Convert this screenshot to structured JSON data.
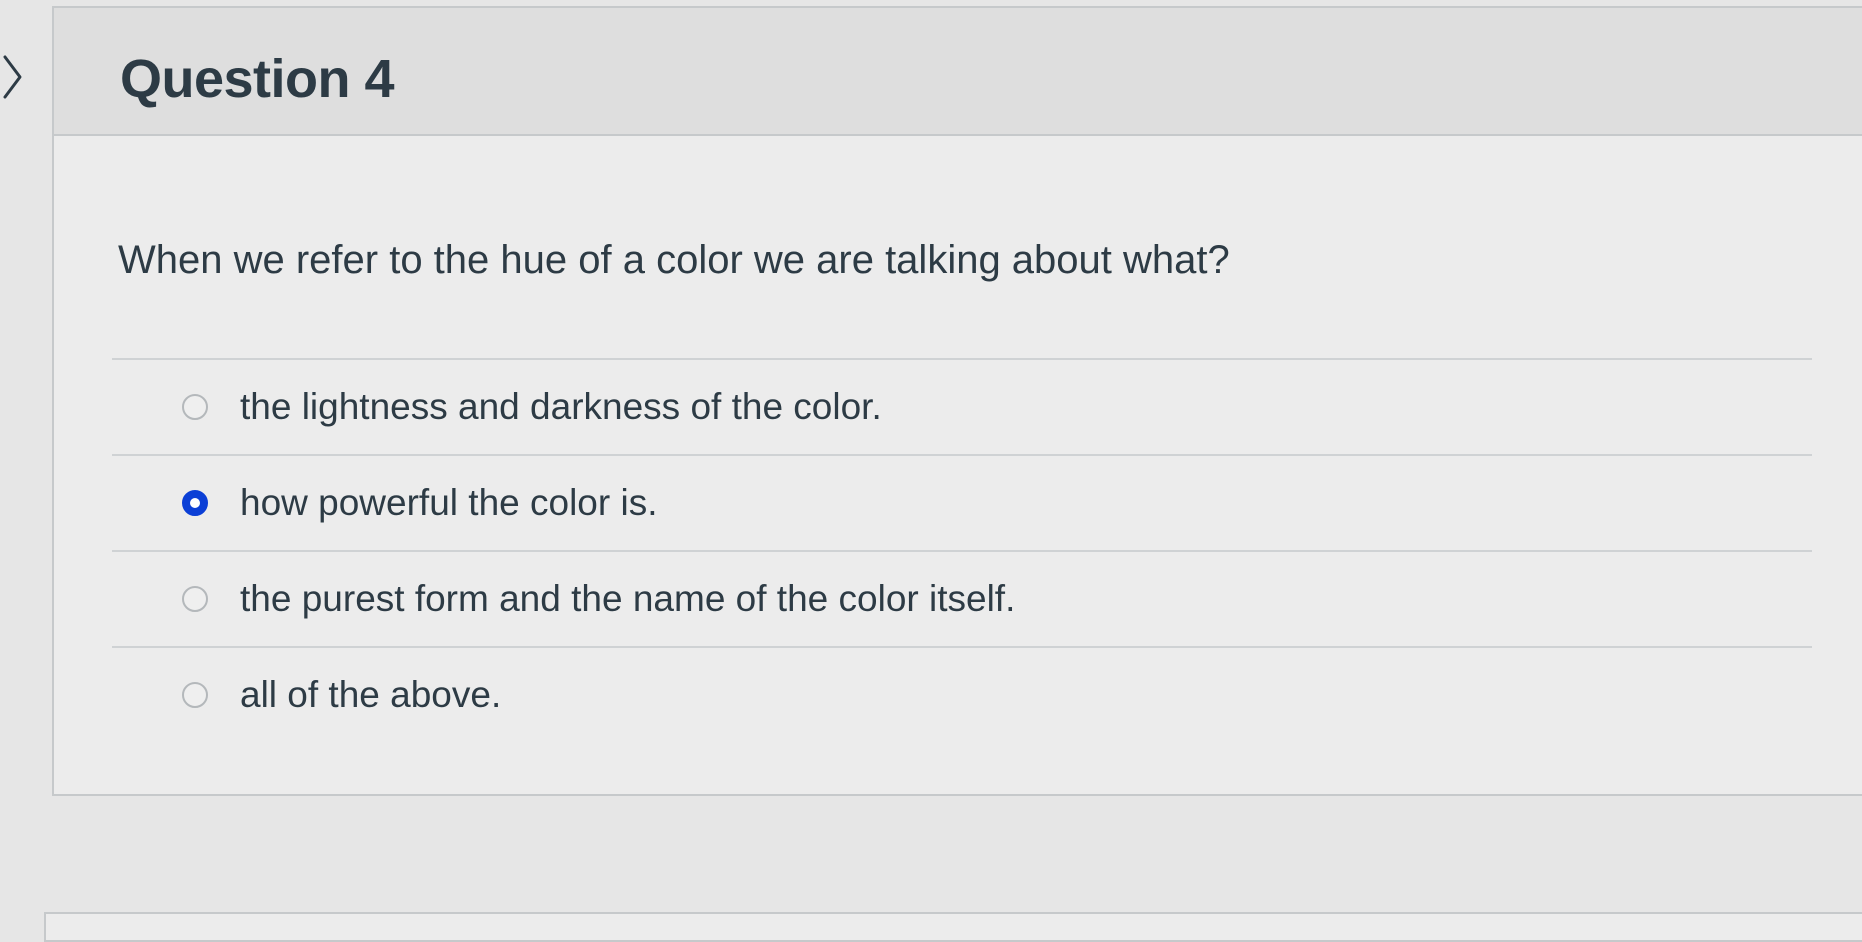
{
  "question": {
    "title": "Question 4",
    "prompt": "When we refer to the hue of a color we are talking about what?",
    "answers": [
      {
        "label": "the lightness and darkness of the color.",
        "selected": false
      },
      {
        "label": "how powerful the color is.",
        "selected": true
      },
      {
        "label": "the purest form and the name of the color itself.",
        "selected": false
      },
      {
        "label": "all of the above.",
        "selected": false
      }
    ]
  },
  "icons": {
    "previous": "chevron-right-icon",
    "radio": "radio-button-icon"
  },
  "colors": {
    "selected_radio": "#0b3fd6",
    "text": "#2d3b45",
    "background": "#e6e6e6"
  }
}
